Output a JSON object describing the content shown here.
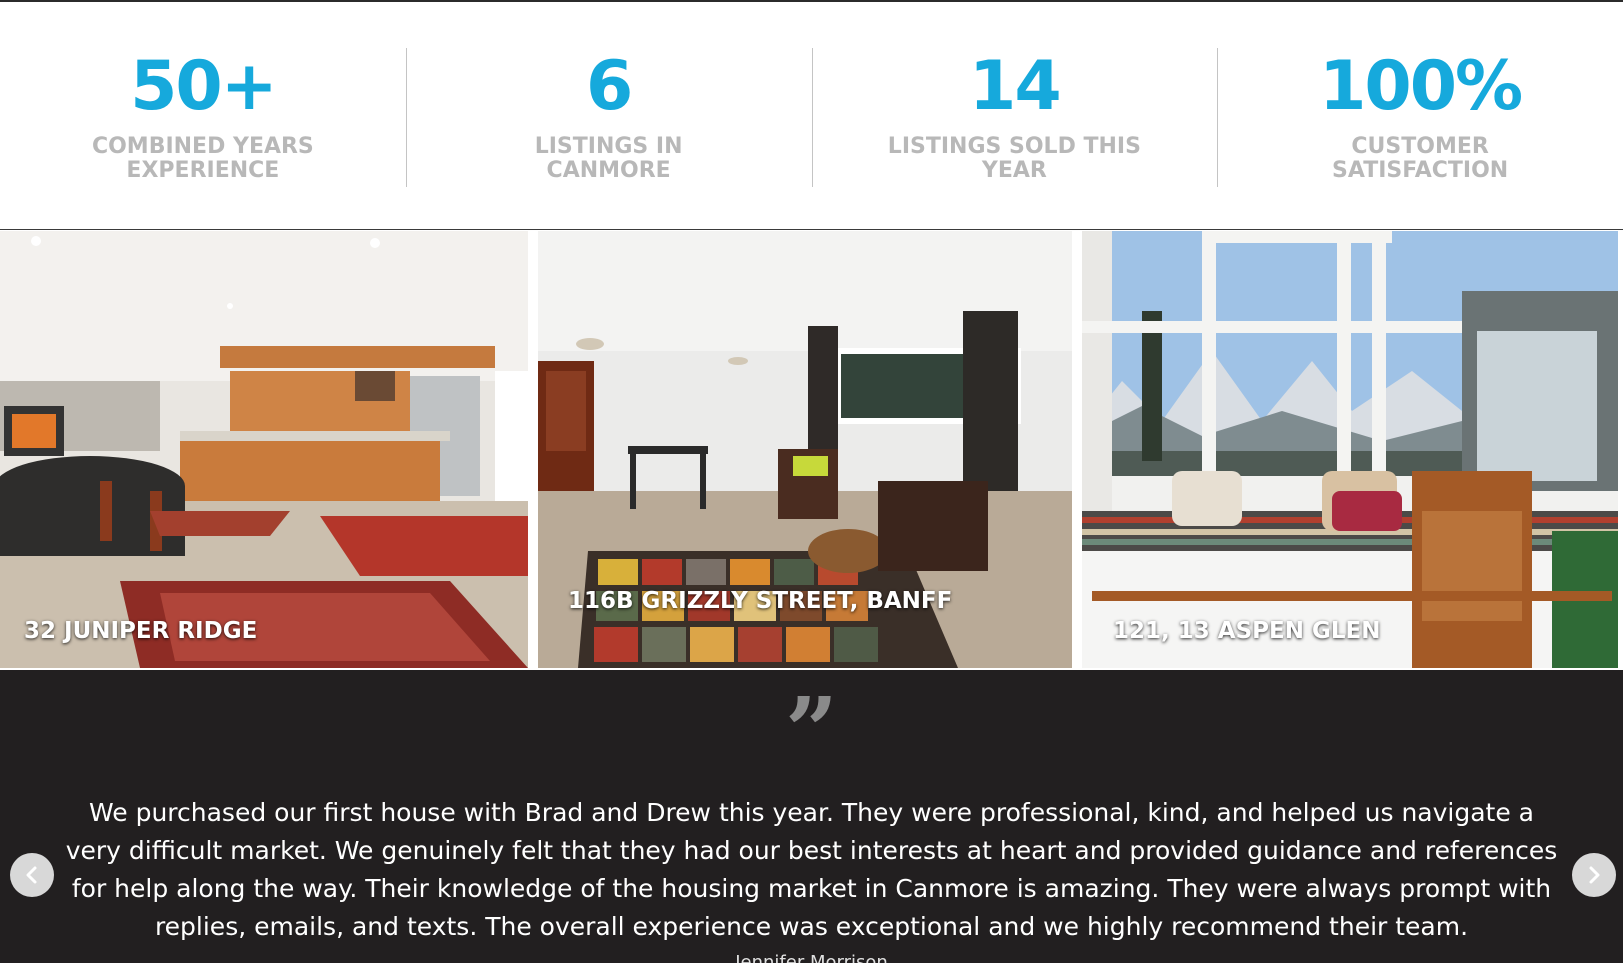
{
  "stats": [
    {
      "value": "50+",
      "label": "COMBINED YEARS EXPERIENCE"
    },
    {
      "value": "6",
      "label": "LISTINGS IN CANMORE"
    },
    {
      "value": "14",
      "label": "LISTINGS SOLD THIS YEAR"
    },
    {
      "value": "100%",
      "label": "CUSTOMER SATISFACTION"
    }
  ],
  "listings": [
    {
      "title": "32 JUNIPER RIDGE"
    },
    {
      "title": "116B GRIZZLY STREET, BANFF"
    },
    {
      "title": "121, 13 ASPEN GLEN"
    }
  ],
  "testimonial": {
    "quote_mark": "”",
    "text": "We purchased our first house with Brad and Drew this year. They were professional, kind, and helped us navigate a very difficult market. We genuinely felt that they had our best interests at heart and provided guidance and references for help along the way. Their knowledge of the housing market in Canmore is amazing. They were always prompt with replies, emails, and texts. The overall experience was exceptional and we highly recommend their team.",
    "author": "Jennifer Morrison"
  },
  "icons": {
    "prev": "chevron-left-icon",
    "next": "chevron-right-icon"
  },
  "colors": {
    "accent": "#16a9dc",
    "label": "#b8b8b8",
    "testimonial_bg": "#221f20"
  }
}
